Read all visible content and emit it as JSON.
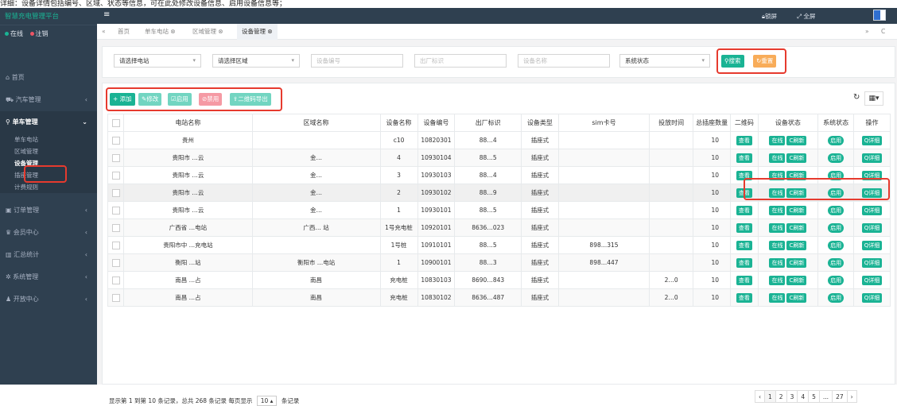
{
  "top_note": "详细：设备详情包括编号、区域、状态等信息，可在此处修改设备信息、启用设备信息等；",
  "sidebar": {
    "logo": "智慧充电管理平台",
    "status_online": "在线",
    "status_logout": "注销",
    "menu": [
      {
        "label": "首页",
        "icon": "home-icon"
      },
      {
        "label": "汽车管理",
        "icon": "car-icon"
      },
      {
        "label": "单车管理",
        "icon": "bike-icon"
      },
      {
        "label": "订单管理",
        "icon": "order-icon"
      },
      {
        "label": "会员中心",
        "icon": "member-icon"
      },
      {
        "label": "汇总统计",
        "icon": "chart-icon"
      },
      {
        "label": "系统管理",
        "icon": "gear-icon"
      },
      {
        "label": "开放中心",
        "icon": "users-icon"
      }
    ],
    "submenu": [
      "单车电站",
      "区域管理",
      "设备管理",
      "插座管理",
      "计费规则"
    ]
  },
  "topbar": {
    "lock": "锁屏",
    "fullscreen": "全屏"
  },
  "tabs": [
    "首页",
    "单车电站",
    "区域管理",
    "设备管理"
  ],
  "filters": {
    "station": "请选择电站",
    "area": "请选择区域",
    "device_no": "设备编号",
    "factory_id": "出厂标识",
    "device_name": "设备名称",
    "system_status": "系统状态",
    "search": "搜索",
    "reset": "重置"
  },
  "toolbar": {
    "add": "添加",
    "edit": "修改",
    "enable": "启用",
    "disable": "禁用",
    "export": "二维码导出"
  },
  "table": {
    "headers": [
      "电站名称",
      "区域名称",
      "设备名称",
      "设备编号",
      "出厂标识",
      "设备类型",
      "sim卡号",
      "投放时间",
      "总插座数量",
      "二维码",
      "设备状态",
      "系统状态",
      "操作"
    ],
    "rows": [
      {
        "station": "贵州",
        "area": "",
        "name": "c10",
        "no": "10820301",
        "factory": "88…4",
        "type": "插座式",
        "sim": "",
        "time": "",
        "count": "10"
      },
      {
        "station": "贵阳市 …云",
        "area": "金…",
        "name": "4",
        "no": "10930104",
        "factory": "88…5",
        "type": "插座式",
        "sim": "",
        "time": "",
        "count": "10"
      },
      {
        "station": "贵阳市 …云",
        "area": "金…",
        "name": "3",
        "no": "10930103",
        "factory": "88…4",
        "type": "插座式",
        "sim": "",
        "time": "",
        "count": "10"
      },
      {
        "station": "贵阳市 …云",
        "area": "金…",
        "name": "2",
        "no": "10930102",
        "factory": "88…9",
        "type": "插座式",
        "sim": "",
        "time": "",
        "count": "10"
      },
      {
        "station": "贵阳市 …云",
        "area": "金…",
        "name": "1",
        "no": "10930101",
        "factory": "88…5",
        "type": "插座式",
        "sim": "",
        "time": "",
        "count": "10"
      },
      {
        "station": "广西省 …电站",
        "area": "广西… 站",
        "name": "1号充电桩",
        "no": "10920101",
        "factory": "8636…023",
        "type": "插座式",
        "sim": "",
        "time": "",
        "count": "10"
      },
      {
        "station": "贵阳市中 …充电站",
        "area": "",
        "name": "1号桩",
        "no": "10910101",
        "factory": "88…5",
        "type": "插座式",
        "sim": "898…315",
        "time": "",
        "count": "10"
      },
      {
        "station": "衡阳 …站",
        "area": "衡阳市 …电站",
        "name": "1",
        "no": "10900101",
        "factory": "88…3",
        "type": "插座式",
        "sim": "898…447",
        "time": "",
        "count": "10"
      },
      {
        "station": "南昌 …占",
        "area": "南昌",
        "name": "充电桩",
        "no": "10830103",
        "factory": "8690…843",
        "type": "插座式",
        "sim": "",
        "time": "2…0",
        "count": "10"
      },
      {
        "station": "南昌 …占",
        "area": "南昌",
        "name": "充电桩",
        "no": "10830102",
        "factory": "8636…487",
        "type": "插座式",
        "sim": "",
        "time": "2…0",
        "count": "10"
      }
    ],
    "tag_view": "查看",
    "tag_online": "在线",
    "tag_refresh": "C刷新",
    "tag_enabled": "启用",
    "tag_detail": "Q详细"
  },
  "footer": {
    "summary": "显示第 1 到第 10 条记录，总共 268 条记录 每页显示",
    "page_size": "10",
    "suffix": "条记录"
  },
  "pagination": [
    "‹",
    "1",
    "2",
    "3",
    "4",
    "5",
    "...",
    "27",
    "›"
  ],
  "colors": {
    "sidebar": "#2f4050",
    "accent": "#1ab394",
    "warning": "#f8ac59",
    "danger": "#ed5565",
    "highlight": "#e63a2e"
  }
}
